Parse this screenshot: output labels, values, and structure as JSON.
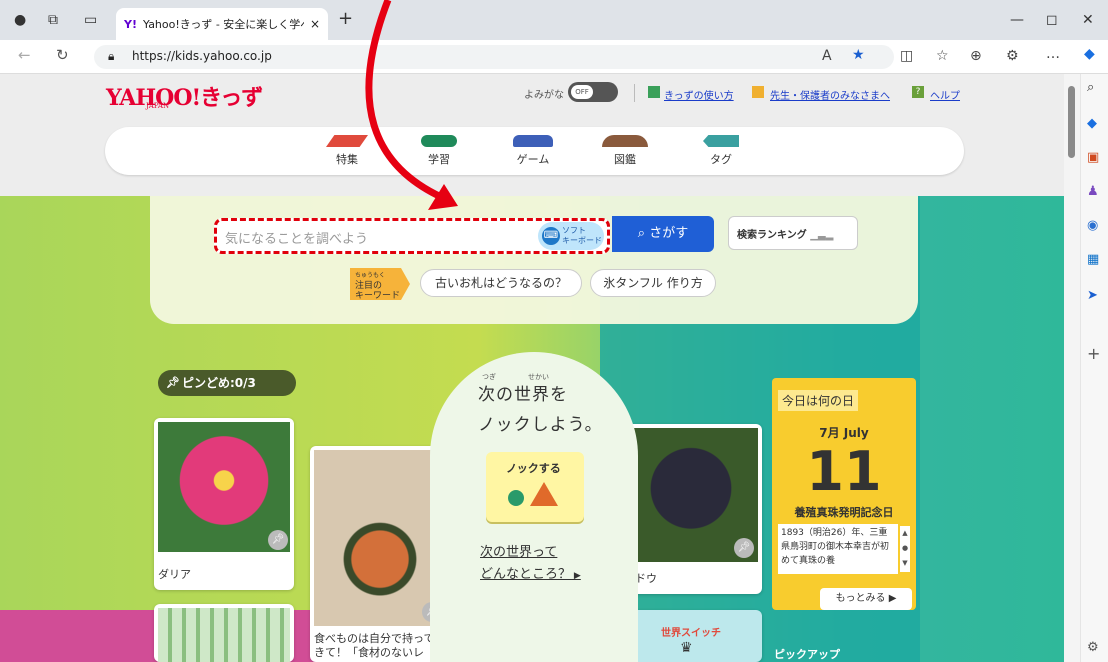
{
  "browser": {
    "tab_title": "Yahoo!きっず - 安全に楽しく学べるヲ",
    "tab_favicon": "Y!",
    "tab_close": "×",
    "new_tab": "+",
    "url": "https://kids.yahoo.co.jp",
    "window_controls": [
      "—",
      "◻",
      "✕"
    ]
  },
  "header": {
    "logo_text": "YAHOO!",
    "logo_kids": "きっず",
    "logo_japan": "JAPAN",
    "yomigana_label": "よみがな",
    "toggle_state": "OFF",
    "links": [
      "きっずの使い方",
      "先生・保護者のみなさまへ",
      "ヘルプ"
    ]
  },
  "nav": {
    "items": [
      {
        "label": "特集",
        "color": "#e04a3c"
      },
      {
        "label": "学習",
        "color": "#1f8a5a"
      },
      {
        "label": "ゲーム",
        "color": "#3d5fb8"
      },
      {
        "label": "図鑑",
        "color": "#8a5a3c"
      },
      {
        "label": "タグ",
        "color": "#3aa0a0"
      }
    ]
  },
  "search": {
    "placeholder": "気になることを調べよう",
    "soft_keyboard": [
      "ソフト",
      "キーボード"
    ],
    "button": "さがす",
    "ranking": "検索ランキング",
    "keyword_tag_ruby": "ちゅうもく",
    "keyword_tag": [
      "注目の",
      "キーワード"
    ],
    "keywords": [
      "古いお札はどうなるの？",
      "氷タンフル 作り方"
    ]
  },
  "pin": {
    "label": "ピンどめ:0/3"
  },
  "cards": {
    "dahlia": "ダリア",
    "food": "食べものは自分で持ってきて！「食材のないレ",
    "grape": "ブドウ",
    "switch_label": "世界スイッチ",
    "pickup": "ピックアップ"
  },
  "knock": {
    "line1": "次の世界を",
    "line2": "ノックしよう。",
    "ruby1": "つぎ",
    "ruby2": "せかい",
    "button": "ノックする",
    "link1": "次の世界って",
    "link2": "どんなところ？"
  },
  "today": {
    "heading": "今日は何の日",
    "month": "7月 July",
    "day": "11",
    "event": "養殖真珠発明記念日",
    "body": "1893（明治26）年、三重県鳥羽町の御木本幸吉が初めて真珠の養",
    "more": "もっとみる"
  }
}
